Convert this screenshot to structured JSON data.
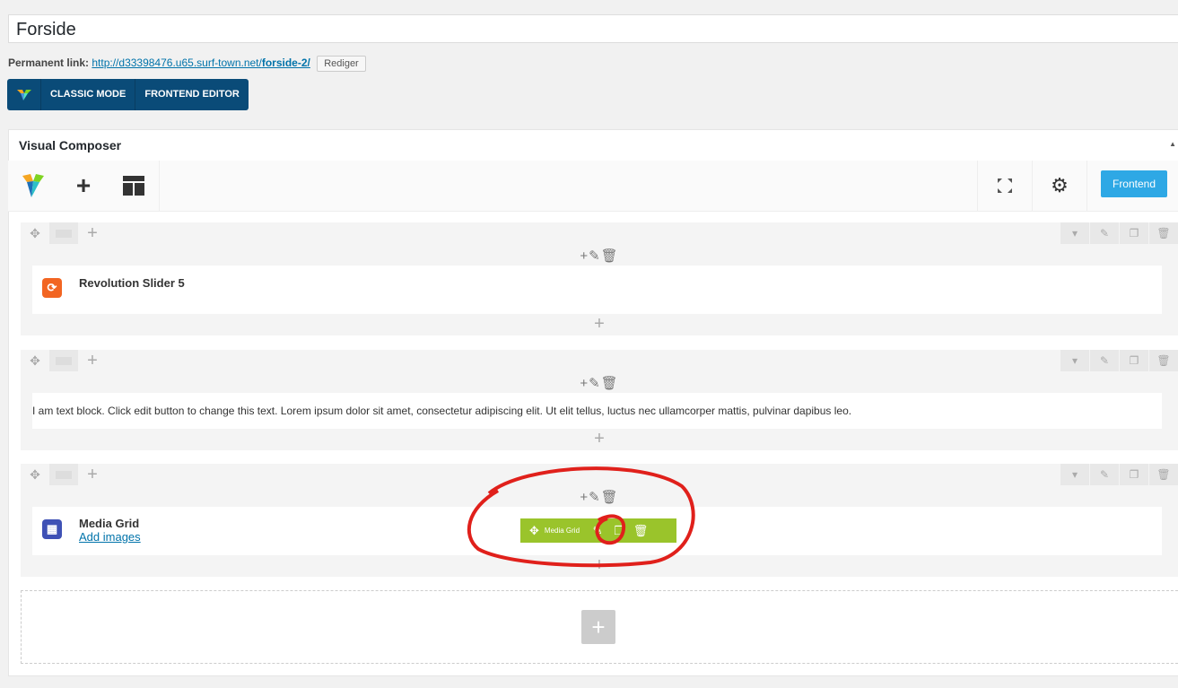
{
  "post": {
    "title": "Forside",
    "permalink_label": "Permanent link:",
    "permalink_url_prefix": "http://d33398476.u65.surf-town.net/",
    "permalink_slug": "forside-2/",
    "edit_button": "Rediger"
  },
  "mode_bar": {
    "classic_mode": "CLASSIC MODE",
    "frontend_editor": "FRONTEND EDITOR"
  },
  "composer": {
    "title": "Visual Composer",
    "frontend_button": "Frontend"
  },
  "rows": [
    {
      "element_title": "Revolution Slider 5"
    },
    {
      "element_text": "I am text block. Click edit button to change this text. Lorem ipsum dolor sit amet, consectetur adipiscing elit. Ut elit tellus, luctus nec ullamcorper mattis, pulvinar dapibus leo."
    },
    {
      "element_title": "Media Grid",
      "element_link": "Add images",
      "hover_label": "Media Grid"
    }
  ],
  "colors": {
    "mode_bar_bg": "#0a4b78",
    "frontend_btn": "#2ea8e5",
    "revslider_icon": "#f26522",
    "media_grid_icon": "#3f51b5",
    "element_hover_bar": "#9ac42b",
    "annotation": "#e0201b"
  }
}
